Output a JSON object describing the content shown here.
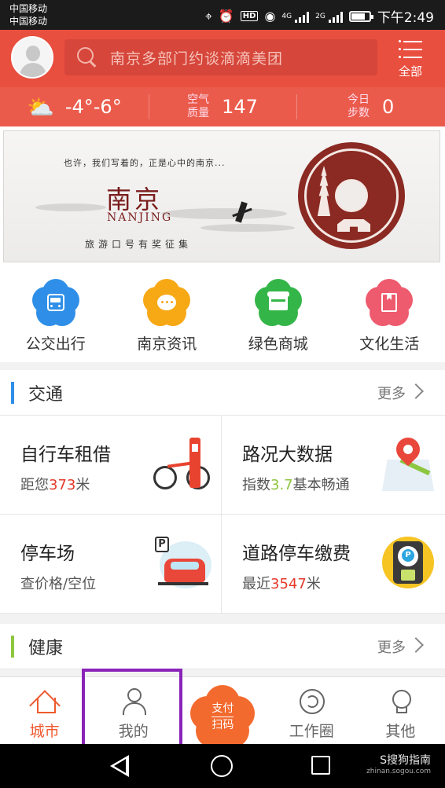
{
  "status_bar": {
    "carrier_1": "中国移动",
    "carrier_2": "中国移动",
    "net1": "4G",
    "net2": "2G",
    "hd": "HD",
    "time": "下午2:49"
  },
  "header": {
    "search_placeholder": "南京多部门约谈滴滴美团",
    "menu_label": "全部"
  },
  "weather": {
    "temperature": "-4°-6°",
    "aqi_label_1": "空气",
    "aqi_label_2": "质量",
    "aqi_value": "147",
    "steps_label_1": "今日",
    "steps_label_2": "步数",
    "steps_value": "0"
  },
  "banner": {
    "tagline": "也许，我们写着的，正是心中的南京...",
    "title": "南京",
    "subtitle": "NANJING",
    "slogan": "旅游口号有奖征集"
  },
  "quick_links": [
    {
      "label": "公交出行",
      "icon": "bus-icon",
      "color": "#2f8fe8"
    },
    {
      "label": "南京资讯",
      "icon": "chat-icon",
      "color": "#f7a815"
    },
    {
      "label": "绿色商城",
      "icon": "shop-icon",
      "color": "#34b548"
    },
    {
      "label": "文化生活",
      "icon": "book-icon",
      "color": "#ee5b6e"
    }
  ],
  "sections": {
    "traffic": {
      "title": "交通",
      "more": "更多",
      "bar_color": "#2f8fe8"
    },
    "health": {
      "title": "健康",
      "more": "更多",
      "bar_color": "#8ec63f"
    }
  },
  "cards": {
    "bike": {
      "title": "自行车租借",
      "sub_prefix": "距您",
      "sub_value": "373",
      "sub_suffix": "米"
    },
    "traffic_data": {
      "title": "路况大数据",
      "sub_prefix": "指数",
      "sub_value": "3.7",
      "sub_suffix": "基本畅通"
    },
    "parking": {
      "title": "停车场",
      "sub": "查价格/空位"
    },
    "road_fee": {
      "title": "道路停车缴费",
      "sub_prefix": "最近",
      "sub_value": "3547",
      "sub_suffix": "米"
    }
  },
  "tabbar": {
    "city": "城市",
    "mine": "我的",
    "pay_line1": "支付",
    "pay_line2": "扫码",
    "work": "工作圈",
    "other": "其他"
  },
  "watermark": {
    "line1": "S搜狗指南",
    "line2": "zhinan.sogou.com"
  },
  "colors": {
    "header_red": "#e94f3f",
    "accent_orange": "#ef5a2e",
    "highlight_purple": "#8a24b8"
  }
}
